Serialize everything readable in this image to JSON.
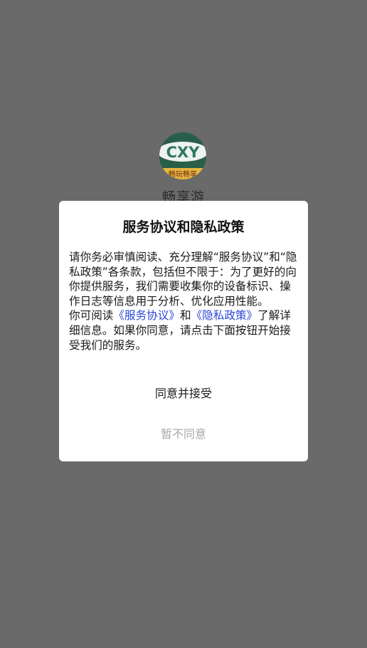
{
  "app": {
    "name": "畅享游",
    "logo_text": "CXY",
    "logo_subtext": "畅玩畅享"
  },
  "dialog": {
    "title": "服务协议和隐私政策",
    "body_part1": "请你务必审慎阅读、充分理解“服务协议”和“隐私政策”各条款，包括但不限于：为了更好的向你提供服务，我们需要收集你的设备标识、操作日志等信息用于分析、优化应用性能。",
    "body_part2_prefix": "你可阅读",
    "service_link": "《服务协议》",
    "and_text": "和",
    "privacy_link": "《隐私政策》",
    "body_part2_suffix": "了解详细信息。如果你同意，请点击下面按钮开始接受我们的服务。",
    "agree_label": "同意并接受",
    "disagree_label": "暂不同意"
  },
  "colors": {
    "overlay": "#6a6a6a",
    "link": "#2a45d8",
    "disabled_text": "#a8a8a8",
    "logo_green": "#295f4a",
    "logo_band": "#e8b440"
  }
}
